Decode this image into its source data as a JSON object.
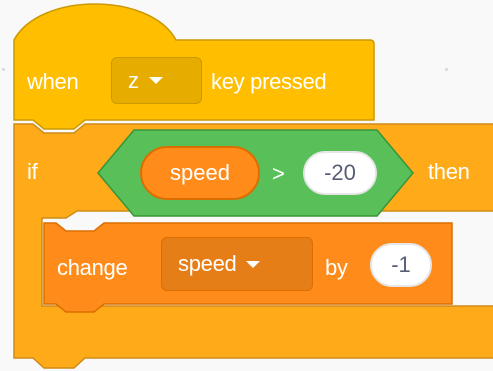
{
  "script": {
    "hat": {
      "when_label": "when",
      "key_value": "z",
      "key_pressed_label": "key pressed",
      "color": "#ffbf00",
      "border_color": "#cc9900"
    },
    "if_block": {
      "if_label": "if",
      "then_label": "then",
      "color": "#ffab19",
      "border_color": "#cf8b17",
      "condition": {
        "color": "#59c059",
        "border_color": "#389438",
        "left_reporter": "speed",
        "operator": ">",
        "right_value": "-20"
      }
    },
    "change_block": {
      "change_label": "change",
      "variable_value": "speed",
      "by_label": "by",
      "amount_value": "-1",
      "color": "#ff8c1a",
      "border_color": "#db6e00"
    }
  }
}
